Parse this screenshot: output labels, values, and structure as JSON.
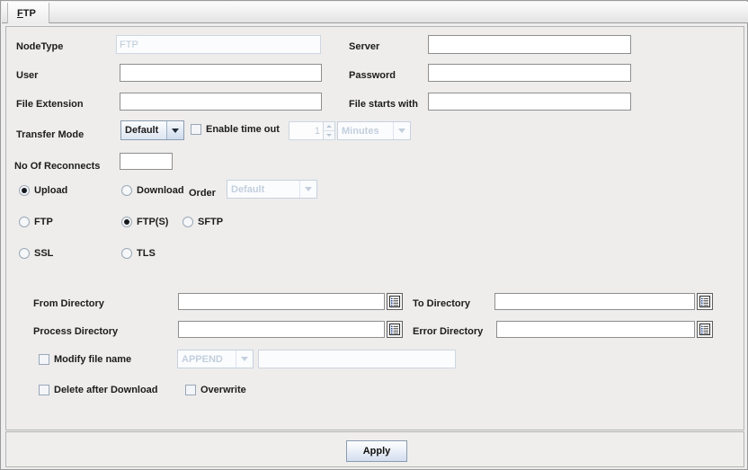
{
  "window": {
    "tab_label": "FTP",
    "tab_mnemonic": "F",
    "tab_rest": "TP"
  },
  "form": {
    "node_type": {
      "label": "NodeType",
      "value": "FTP",
      "disabled": true
    },
    "server": {
      "label": "Server",
      "value": ""
    },
    "user": {
      "label": "User",
      "value": ""
    },
    "password": {
      "label": "Password",
      "value": ""
    },
    "file_extension": {
      "label": "File Extension",
      "value": ""
    },
    "file_starts_with": {
      "label": "File starts with",
      "value": ""
    },
    "transfer_mode": {
      "label": "Transfer Mode",
      "value": "Default",
      "options": [
        "Default"
      ]
    },
    "enable_time_out": {
      "label": "Enable time out",
      "checked": false
    },
    "time_out_value": {
      "value": "1",
      "disabled": true
    },
    "time_out_unit": {
      "value": "Minutes",
      "disabled": true,
      "options": [
        "Minutes"
      ]
    },
    "no_of_reconnects": {
      "label": "No Of Reconnects",
      "value": ""
    },
    "direction": {
      "upload_label": "Upload",
      "download_label": "Download",
      "selected": "Upload"
    },
    "order": {
      "label": "Order",
      "value": "Default",
      "disabled": true,
      "options": [
        "Default"
      ]
    },
    "protocol": {
      "ftp_label": "FTP",
      "ftps_label": "FTP(S)",
      "sftp_label": "SFTP",
      "selected": "FTP(S)"
    },
    "security": {
      "ssl_label": "SSL",
      "tls_label": "TLS",
      "selected": ""
    },
    "from_directory": {
      "label": "From Directory",
      "value": ""
    },
    "to_directory": {
      "label": "To Directory",
      "value": ""
    },
    "process_directory": {
      "label": "Process Directory",
      "value": ""
    },
    "error_directory": {
      "label": "Error Directory",
      "value": ""
    },
    "modify_file_name": {
      "label": "Modify file name",
      "checked": false
    },
    "modify_mode": {
      "value": "APPEND",
      "disabled": true,
      "options": [
        "APPEND"
      ]
    },
    "modify_text": {
      "value": ""
    },
    "delete_after_download": {
      "label": "Delete after Download",
      "checked": false
    },
    "overwrite": {
      "label": "Overwrite",
      "checked": false
    }
  },
  "actions": {
    "apply_label": "Apply"
  },
  "colors": {
    "panel_bg": "#eeedec",
    "field_border": "#8e8e8e",
    "disabled_text": "#bcc9d8",
    "combo_border": "#8a9bb0"
  }
}
